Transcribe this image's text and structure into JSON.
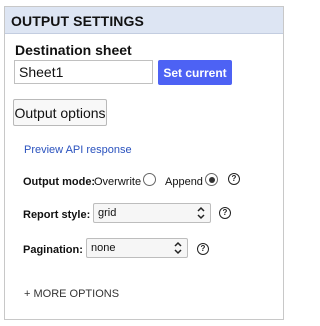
{
  "panel": {
    "title": "OUTPUT SETTINGS"
  },
  "destination": {
    "label": "Destination sheet",
    "value": "Sheet1",
    "set_current_label": "Set current"
  },
  "output_options_label": "Output options",
  "preview_link_label": "Preview API response",
  "output_mode": {
    "label": "Output mode:",
    "options": [
      {
        "label": "Overwrite",
        "checked": false
      },
      {
        "label": "Append",
        "checked": true
      }
    ],
    "help_icon": "help-circle-icon"
  },
  "report_style": {
    "label": "Report style:",
    "selected": "grid",
    "help_icon": "help-circle-icon"
  },
  "pagination": {
    "label": "Pagination:",
    "selected": "none",
    "help_icon": "help-circle-icon"
  },
  "more_options_label": "+ MORE OPTIONS",
  "colors": {
    "header_bg": "#dde5f3",
    "primary_button": "#4d62f4",
    "link": "#2a52be"
  }
}
